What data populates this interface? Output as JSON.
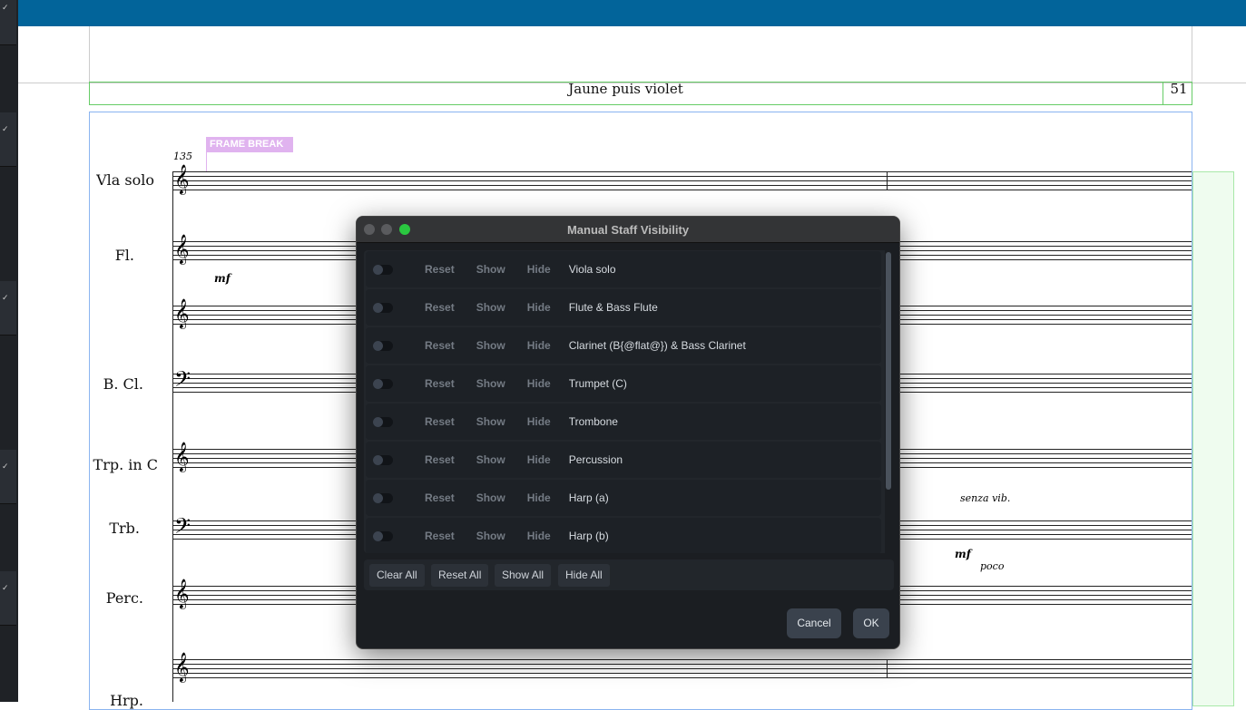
{
  "score": {
    "title": "Jaune puis violet",
    "page_number": "51",
    "frame_break": "FRAME BREAK",
    "bar_number": "135",
    "instruments": [
      "Vla solo",
      "Fl.",
      "B. Cl.",
      "Trp. in C",
      "Trb.",
      "Perc.",
      "Hrp."
    ],
    "dynamics": {
      "fl": "mf",
      "trb": "mf",
      "poco": "poco",
      "senza": "senza vib."
    }
  },
  "dialog": {
    "title": "Manual Staff Visibility",
    "row_buttons": {
      "reset": "Reset",
      "show": "Show",
      "hide": "Hide"
    },
    "rows": [
      {
        "name": "Viola solo",
        "enabled": false
      },
      {
        "name": "Flute & Bass Flute",
        "enabled": false
      },
      {
        "name": "Clarinet (B{@flat@}) & Bass Clarinet",
        "enabled": false
      },
      {
        "name": "Trumpet (C)",
        "enabled": false
      },
      {
        "name": "Trombone",
        "enabled": false
      },
      {
        "name": "Percussion",
        "enabled": false
      },
      {
        "name": "Harp (a)",
        "enabled": false
      },
      {
        "name": "Harp (b)",
        "enabled": false
      }
    ],
    "footer_buttons": {
      "clear_all": "Clear All",
      "reset_all": "Reset All",
      "show_all": "Show All",
      "hide_all": "Hide All"
    },
    "cancel": "Cancel",
    "ok": "OK"
  }
}
